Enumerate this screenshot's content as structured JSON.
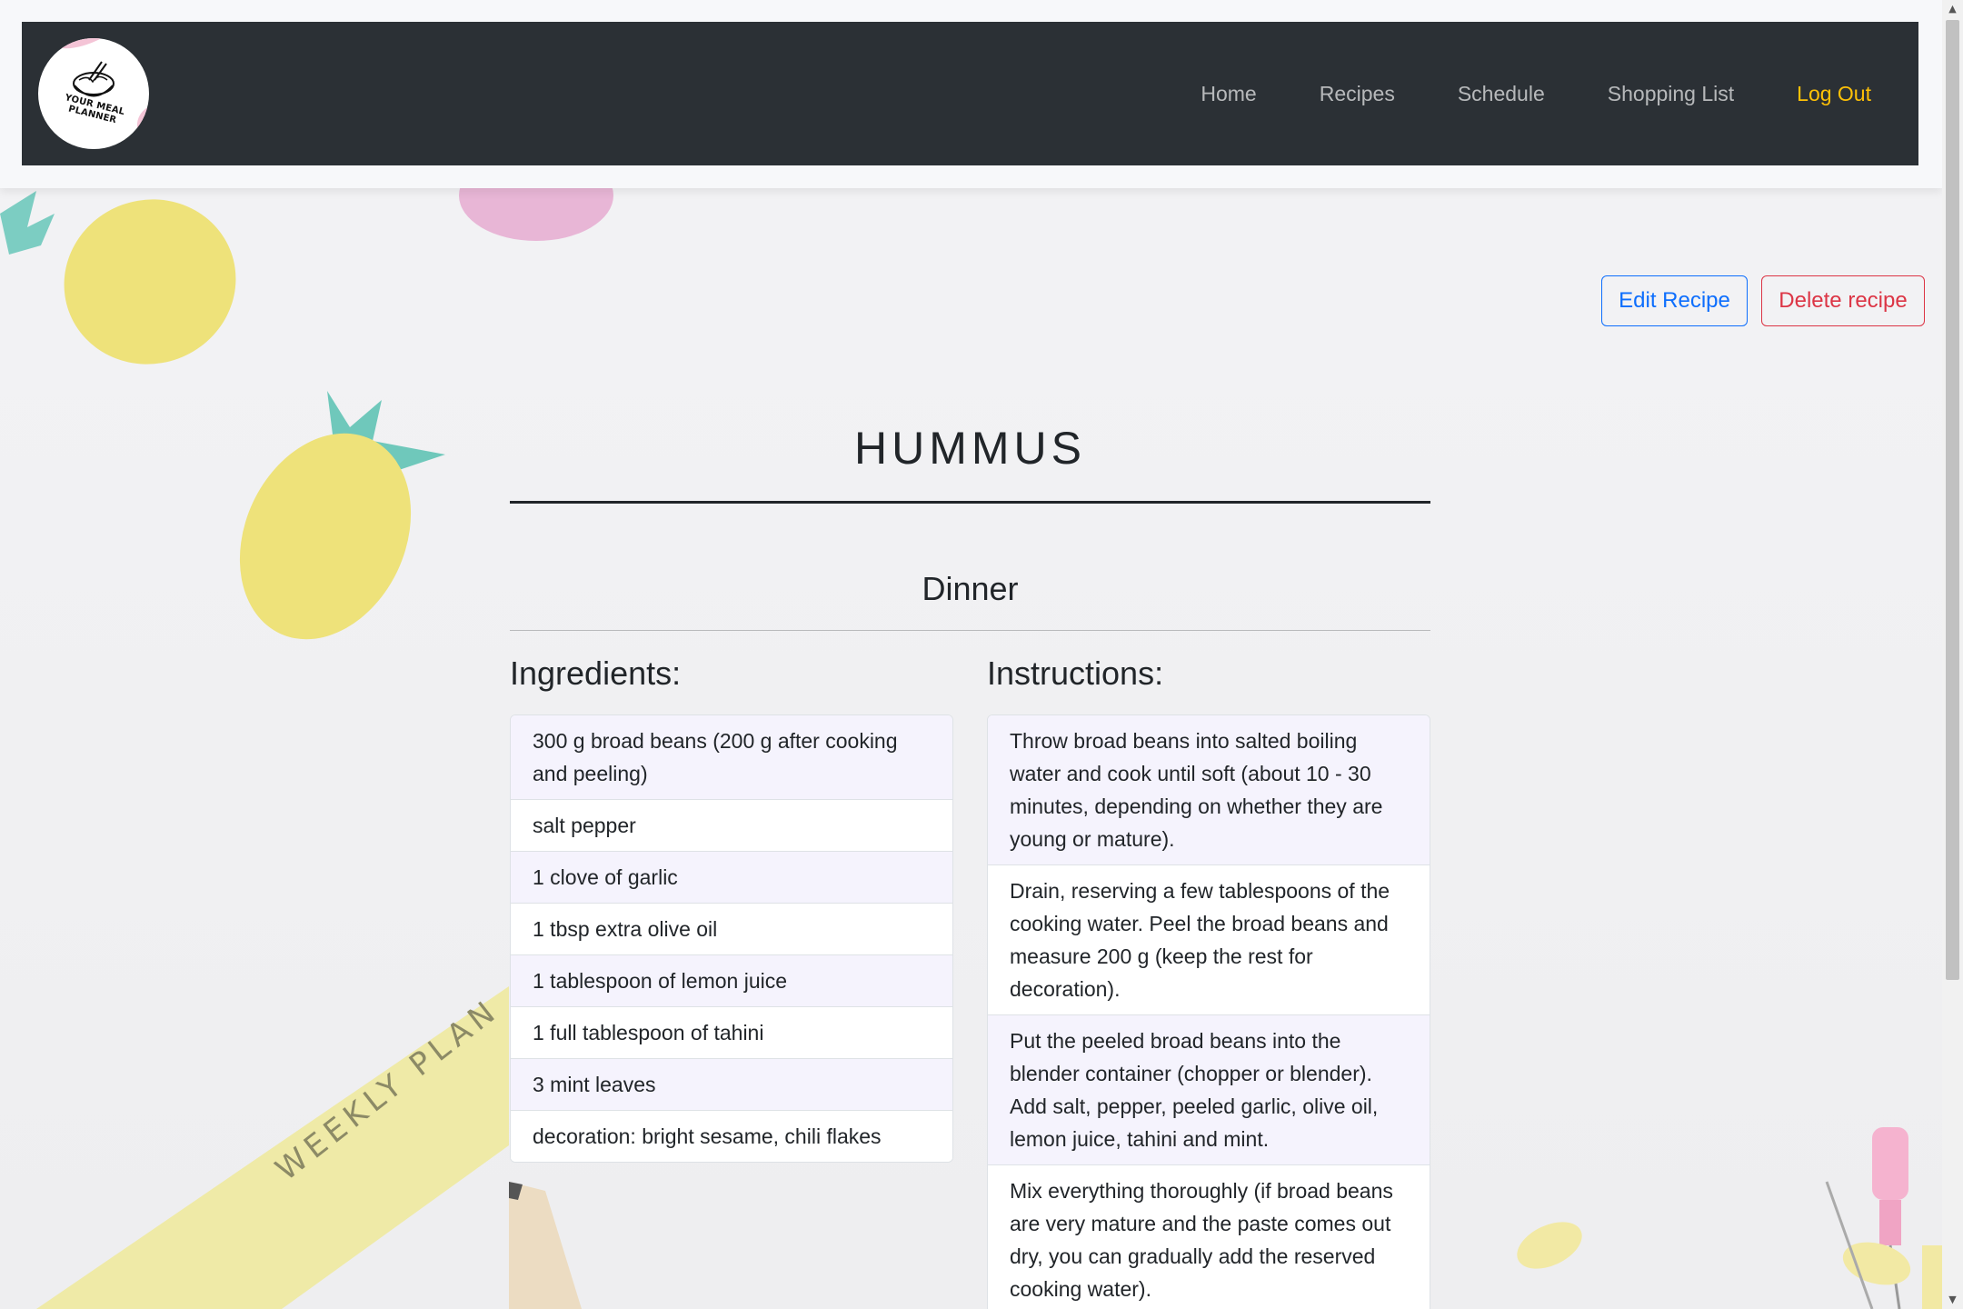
{
  "nav": {
    "logo_text": "YOUR MEAL PLANNER",
    "links": [
      {
        "label": "Home"
      },
      {
        "label": "Recipes"
      },
      {
        "label": "Schedule"
      },
      {
        "label": "Shopping List"
      },
      {
        "label": "Log Out",
        "accent": "#ffc107"
      }
    ]
  },
  "actions": {
    "edit_label": "Edit Recipe",
    "delete_label": "Delete recipe"
  },
  "recipe": {
    "title": "HUMMUS",
    "category": "Dinner",
    "ingredients_heading": "Ingredients:",
    "instructions_heading": "Instructions:",
    "ingredients": [
      "300 g broad beans (200 g after cooking and peeling)",
      "salt pepper",
      "1 clove of garlic",
      "1 tbsp extra olive oil",
      "1 tablespoon of lemon juice",
      "1 full tablespoon of tahini",
      "3 mint leaves",
      "decoration: bright sesame, chili flakes"
    ],
    "instructions": [
      "Throw broad beans into salted boiling water and cook until soft (about 10 - 30 minutes, depending on whether they are young or mature).",
      "Drain, reserving a few tablespoons of the cooking water. Peel the broad beans and measure 200 g (keep the rest for decoration).",
      "Put the peeled broad beans into the blender container (chopper or blender). Add salt, pepper, peeled garlic, olive oil, lemon juice, tahini and mint.",
      "Mix everything thoroughly (if broad beans are very mature and the paste comes out dry, you can gradually add the reserved cooking water)."
    ]
  },
  "background": {
    "ribbon_text": "WEEKLY PLAN"
  },
  "colors": {
    "navbar": "#2b3035",
    "primary": "#0d6efd",
    "danger": "#dc3545",
    "logout": "#ffc107",
    "list_stripe": "#f5f3fd"
  }
}
